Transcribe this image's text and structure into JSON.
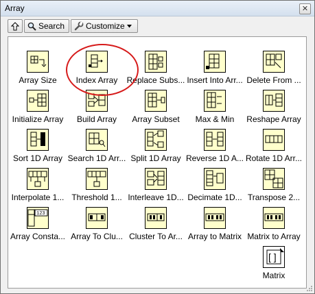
{
  "window": {
    "title": "Array",
    "close_glyph": "✕"
  },
  "toolbar": {
    "up_icon": "up-arrow-icon",
    "search_label": "Search",
    "customize_label": "Customize"
  },
  "palette": {
    "items": [
      {
        "label": "Array Size",
        "icon": "array-size-icon"
      },
      {
        "label": "Index Array",
        "icon": "index-array-icon"
      },
      {
        "label": "Replace Subs...",
        "icon": "replace-subset-icon"
      },
      {
        "label": "Insert Into Arr...",
        "icon": "insert-into-array-icon"
      },
      {
        "label": "Delete From ...",
        "icon": "delete-from-array-icon"
      },
      {
        "label": "Initialize Array",
        "icon": "initialize-array-icon"
      },
      {
        "label": "Build Array",
        "icon": "build-array-icon"
      },
      {
        "label": "Array Subset",
        "icon": "array-subset-icon"
      },
      {
        "label": "Max & Min",
        "icon": "max-min-icon"
      },
      {
        "label": "Reshape Array",
        "icon": "reshape-array-icon"
      },
      {
        "label": "Sort 1D Array",
        "icon": "sort-1d-array-icon"
      },
      {
        "label": "Search 1D Arr...",
        "icon": "search-1d-array-icon"
      },
      {
        "label": "Split 1D Array",
        "icon": "split-1d-array-icon"
      },
      {
        "label": "Reverse 1D A...",
        "icon": "reverse-1d-array-icon"
      },
      {
        "label": "Rotate 1D Arr...",
        "icon": "rotate-1d-array-icon"
      },
      {
        "label": "Interpolate 1...",
        "icon": "interpolate-1d-array-icon"
      },
      {
        "label": "Threshold 1...",
        "icon": "threshold-1d-array-icon"
      },
      {
        "label": "Interleave 1D...",
        "icon": "interleave-1d-arrays-icon"
      },
      {
        "label": "Decimate 1D...",
        "icon": "decimate-1d-array-icon"
      },
      {
        "label": "Transpose 2...",
        "icon": "transpose-2d-array-icon"
      },
      {
        "label": "Array Consta...",
        "icon": "array-constant-icon"
      },
      {
        "label": "Array To Clu...",
        "icon": "array-to-cluster-icon"
      },
      {
        "label": "Cluster To Ar...",
        "icon": "cluster-to-array-icon"
      },
      {
        "label": "Array to Matrix",
        "icon": "array-to-matrix-icon"
      },
      {
        "label": "Matrix to Array",
        "icon": "matrix-to-array-icon"
      },
      {
        "label": "Matrix",
        "icon": "matrix-folder-icon"
      }
    ]
  },
  "annotation": {
    "highlighted_item": "Index Array",
    "color": "#d61a1a"
  },
  "colors": {
    "icon_bg": "#ffffcc",
    "icon_border": "#000000"
  }
}
